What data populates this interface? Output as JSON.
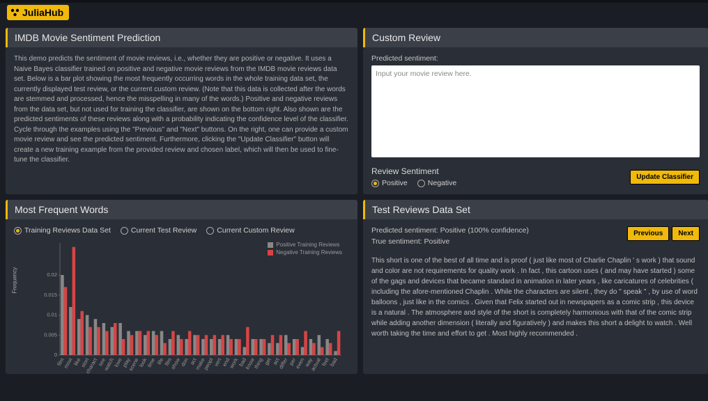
{
  "brand": {
    "name": "JuliaHub"
  },
  "panels": {
    "main": {
      "title": "IMDB Movie Sentiment Prediction",
      "desc": "This demo predicts the sentiment of movie reviews, i.e., whether they are positive or negative. It uses a Naive Bayes classifier trained on positive and negative movie reviews from the IMDB movie reviews data set. Below is a bar plot showing the most frequently occurring words in the whole training data set, the currently displayed test review, or the current custom review. (Note that this data is collected after the words are stemmed and processed, hence the misspelling in many of the words.) Positive and negative reviews from the data set, but not used for training the classifier, are shown on the bottom right. Also shown are the predicted sentiments of these reviews along with a probability indicating the confidence level of the classifier. Cycle through the examples using the \"Previous\" and \"Next\" buttons. On the right, one can provide a custom movie review and see the predicted sentiment. Furthermore, clicking the \"Update Classifier\" button will create a new training example from the provided review and chosen label, which will then be used to fine-tune the classifier."
    },
    "custom": {
      "title": "Custom Review",
      "predicted_label": "Predicted sentiment:",
      "placeholder": "Input your movie review here.",
      "sentiment_title": "Review Sentiment",
      "positive_label": "Positive",
      "negative_label": "Negative",
      "update_btn": "Update Classifier"
    },
    "freq": {
      "title": "Most Frequent Words",
      "radios": [
        "Training Reviews Data Set",
        "Current Test Review",
        "Current Custom Review"
      ],
      "legend": [
        "Positive Training Reviews",
        "Negative Training Reviews"
      ],
      "yaxis": "Frequency"
    },
    "test": {
      "title": "Test Reviews Data Set",
      "predicted": "Predicted sentiment: Positive (100% confidence)",
      "true": "True sentiment: Positive",
      "prev_btn": "Previous",
      "next_btn": "Next",
      "review": "This short is one of the best of all time and is proof ( just like most of Charlie Chaplin ' s work ) that sound and color are not requirements for quality work . In fact , this cartoon uses ( and may have started ) some of the gags and devices that became standard in animation in later years , like caricatures of celebrities ( including the afore-mentioned Chaplin . While the characters are silent , they do \" speak \" , by use of word balloons , just like in the comics . Given that Felix started out in newspapers as a comic strip , this device is a natural . The atmosphere and style of the short is completely harmonious with that of the comic strip while adding another dimension ( literally and figuratively ) and makes this short a delight to watch . Well worth taking the time and effort to get . Most highly recommended ."
    }
  },
  "chart_data": {
    "type": "bar",
    "categories": [
      "film",
      "movi",
      "like",
      "stori",
      "charact",
      "see",
      "watch",
      "love",
      "play",
      "scene",
      "look",
      "time",
      "life",
      "film",
      "show",
      "don",
      "act",
      "make",
      "peopl",
      "vert",
      "end",
      "work",
      "bad",
      "know",
      "thing",
      "get",
      "act",
      "differ",
      "per",
      "even",
      "way",
      "actual",
      "feel",
      "bad"
    ],
    "series": [
      {
        "name": "Positive Training Reviews",
        "color": "#888888",
        "values": [
          0.02,
          0.012,
          0.009,
          0.01,
          0.009,
          0.008,
          0.007,
          0.008,
          0.006,
          0.006,
          0.005,
          0.006,
          0.006,
          0.004,
          0.005,
          0.004,
          0.005,
          0.004,
          0.004,
          0.004,
          0.005,
          0.004,
          0.002,
          0.004,
          0.004,
          0.003,
          0.003,
          0.005,
          0.004,
          0.002,
          0.004,
          0.005,
          0.004,
          0.001
        ]
      },
      {
        "name": "Negative Training Reviews",
        "color": "#d64545",
        "values": [
          0.017,
          0.027,
          0.011,
          0.007,
          0.007,
          0.006,
          0.008,
          0.004,
          0.005,
          0.006,
          0.006,
          0.005,
          0.003,
          0.006,
          0.004,
          0.006,
          0.005,
          0.005,
          0.005,
          0.005,
          0.004,
          0.004,
          0.007,
          0.004,
          0.004,
          0.005,
          0.005,
          0.003,
          0.004,
          0.006,
          0.003,
          0.002,
          0.003,
          0.006
        ]
      }
    ],
    "title": "",
    "xlabel": "",
    "ylabel": "Frequency",
    "ylim": [
      0,
      0.028
    ],
    "y_ticks": [
      0,
      0.005,
      0.01,
      0.015,
      0.02
    ]
  }
}
